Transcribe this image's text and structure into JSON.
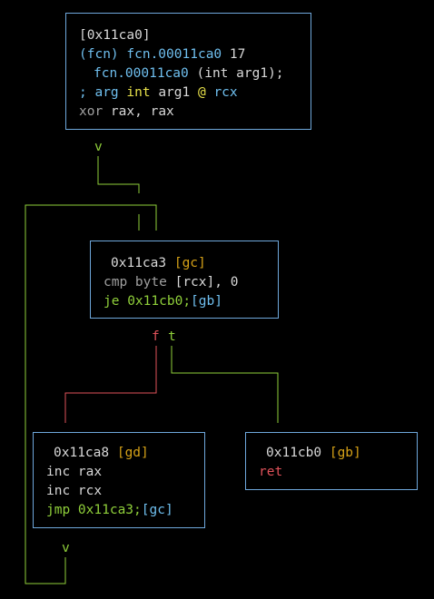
{
  "nodes": {
    "entry": {
      "addr_line": "[0x11ca0]",
      "fcn_prefix": "(fcn) ",
      "fcn_name": "fcn.00011ca0",
      "fcn_size": " 17",
      "sig_name": "fcn.00011ca0",
      "sig_args": " (int arg1);",
      "arg_semicolon": "; ",
      "arg_kw": "arg",
      "arg_type": " int ",
      "arg_name": "arg1",
      "arg_at": " @ ",
      "arg_reg": "rcx",
      "instr_mn": "xor",
      "instr_ops_a": " rax",
      "instr_ops_sep": ", ",
      "instr_ops_b": "rax"
    },
    "gc": {
      "addr": "0x11ca3",
      "tag": "[gc]",
      "cmp_mn": "cmp byte ",
      "cmp_open": "[",
      "cmp_reg": "rcx",
      "cmp_close": "], 0",
      "je_mn": "je ",
      "je_target": "0x11cb0",
      "je_sep": ";",
      "je_ref": "[gb]"
    },
    "gd": {
      "addr": "0x11ca8",
      "tag": "[gd]",
      "inc1_mn": "inc ",
      "inc1_reg": "rax",
      "inc2_mn": "inc ",
      "inc2_reg": "rcx",
      "jmp_mn": "jmp ",
      "jmp_target": "0x11ca3",
      "jmp_sep": ";",
      "jmp_ref": "[gc]"
    },
    "gb": {
      "addr": "0x11cb0",
      "tag": "[gb]",
      "ret_mn": "ret"
    }
  },
  "edge_labels": {
    "entry_out": "v",
    "gc_false": "f",
    "gc_true": "t",
    "gd_out": "v"
  },
  "colors": {
    "node_border": "#6fa8dc",
    "edge_gray": "#d8d8d8",
    "edge_green": "#8fcf3a",
    "edge_red": "#e0525a"
  }
}
